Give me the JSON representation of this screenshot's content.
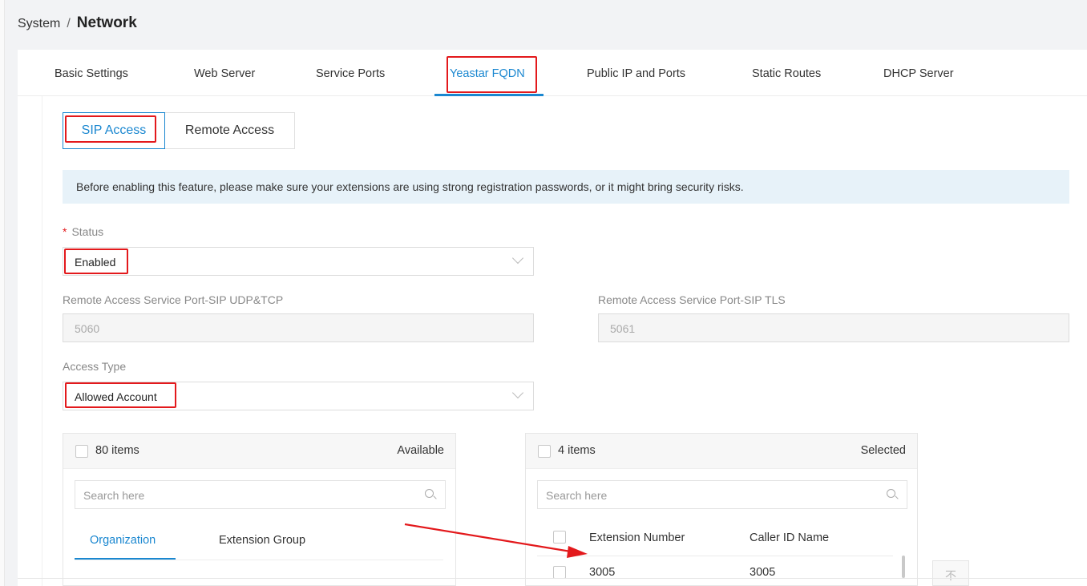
{
  "breadcrumb": {
    "parent": "System",
    "separator": "/",
    "current": "Network"
  },
  "tabs": [
    {
      "label": "Basic Settings"
    },
    {
      "label": "Web Server"
    },
    {
      "label": "Service Ports"
    },
    {
      "label": "Yeastar FQDN",
      "active": true
    },
    {
      "label": "Public IP and Ports"
    },
    {
      "label": "Static Routes"
    },
    {
      "label": "DHCP Server"
    }
  ],
  "subtabs": [
    {
      "label": "SIP Access",
      "active": true
    },
    {
      "label": "Remote Access"
    }
  ],
  "banner": {
    "text": "Before enabling this feature, please make sure your extensions are using strong registration passwords, or it might bring security risks."
  },
  "form": {
    "status": {
      "required_mark": "*",
      "label": "Status",
      "value": "Enabled"
    },
    "sip_udp_tcp": {
      "label": "Remote Access Service Port-SIP UDP&TCP",
      "value": "5060"
    },
    "sip_tls": {
      "label": "Remote Access Service Port-SIP TLS",
      "value": "5061"
    },
    "access_type": {
      "label": "Access Type",
      "value": "Allowed Account"
    }
  },
  "transfer": {
    "available": {
      "count": "80 items",
      "title": "Available",
      "search_placeholder": "Search here",
      "tabs": [
        "Organization",
        "Extension Group"
      ]
    },
    "selected": {
      "count": "4 items",
      "title": "Selected",
      "search_placeholder": "Search here",
      "columns": [
        "Extension Number",
        "Caller ID Name"
      ],
      "rows": [
        {
          "number": "3005",
          "name": "3005"
        }
      ]
    },
    "top_button_icon": "arrow-to-top-icon"
  },
  "colors": {
    "accent": "#1a87d0",
    "annotation": "#e3191c",
    "banner_bg": "#e7f2f9"
  }
}
